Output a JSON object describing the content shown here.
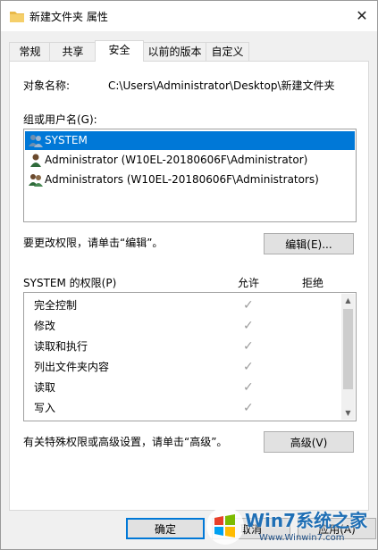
{
  "window": {
    "title": "新建文件夹 属性",
    "close_glyph": "✕"
  },
  "tabs": [
    {
      "label": "常规"
    },
    {
      "label": "共享"
    },
    {
      "label": "安全"
    },
    {
      "label": "以前的版本"
    },
    {
      "label": "自定义"
    }
  ],
  "object": {
    "label": "对象名称:",
    "value": "C:\\Users\\Administrator\\Desktop\\新建文件夹"
  },
  "groups": {
    "label": "组或用户名(G):",
    "items": [
      {
        "name": "SYSTEM",
        "icon": "group-users-icon"
      },
      {
        "name": "Administrator (W10EL-20180606F\\Administrator)",
        "icon": "user-icon"
      },
      {
        "name": "Administrators (W10EL-20180606F\\Administrators)",
        "icon": "group-users-icon"
      }
    ]
  },
  "edit": {
    "prompt": "要更改权限，请单击“编辑”。",
    "button": "编辑(E)..."
  },
  "permissions": {
    "title": "SYSTEM 的权限(P)",
    "allow_header": "允许",
    "deny_header": "拒绝",
    "rows": [
      {
        "name": "完全控制",
        "allow": "✓"
      },
      {
        "name": "修改",
        "allow": "✓"
      },
      {
        "name": "读取和执行",
        "allow": "✓"
      },
      {
        "name": "列出文件夹内容",
        "allow": "✓"
      },
      {
        "name": "读取",
        "allow": "✓"
      },
      {
        "name": "写入",
        "allow": "✓"
      }
    ]
  },
  "advanced": {
    "prompt": "有关特殊权限或高级设置，请单击“高级”。",
    "button": "高级(V)"
  },
  "footer": {
    "ok": "确定",
    "cancel": "取消",
    "apply": "应用(A)"
  },
  "watermark": {
    "brand": "Win7系统之家",
    "url": "Www.Winwin7.com"
  },
  "colors": {
    "selection": "#0078d7",
    "check": "#9b9b9b"
  }
}
